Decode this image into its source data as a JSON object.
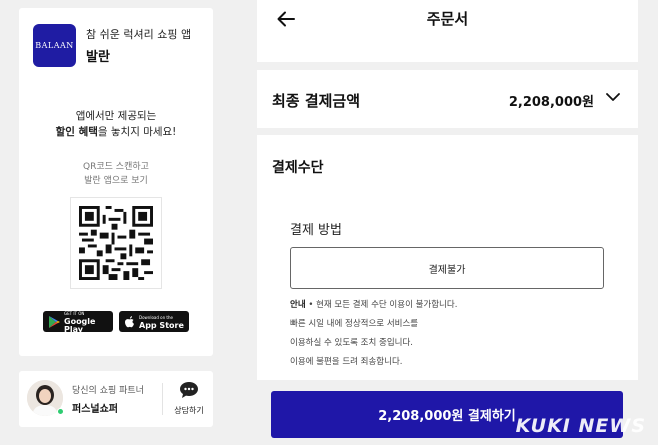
{
  "sidebar": {
    "logo_text": "BALAAN",
    "tagline": "참 쉬운 럭셔리 쇼핑 앱",
    "app_name": "발란",
    "promo_line1": "앱에서만 제공되는",
    "promo_bold": "할인 혜택",
    "promo_line2_rest": "을 놓치지 마세요!",
    "qr_caption_line1": "QR코드 스캔하고",
    "qr_caption_line2": "발란 앱으로 보기",
    "google_play_small": "GET IT ON",
    "google_play_big": "Google Play",
    "app_store_small": "Download on the",
    "app_store_big": "App Store"
  },
  "partner": {
    "subtitle": "당신의 쇼핑 파트너",
    "name": "퍼스널쇼퍼",
    "consult_label": "상담하기"
  },
  "header": {
    "title": "주문서"
  },
  "total": {
    "label": "최종 결제금액",
    "value": "2,208,000원"
  },
  "payment": {
    "section_title": "결제수단",
    "method_label": "결제 방법",
    "method_value": "결제불가",
    "notice_prefix": "안내",
    "notice_line1": " • 현재 모든 결제 수단 이용이 불가합니다.",
    "notice_line2": "빠른 시일 내에 정상적으로 서비스를",
    "notice_line3": "이용하실 수 있도록 조치 중입니다.",
    "notice_line4": "이용에 불편을 드려 죄송합니다."
  },
  "pay_button": {
    "label": "2,208,000원 결제하기"
  },
  "watermark": "KUKI NEWS",
  "colors": {
    "brand": "#1f17a8",
    "background": "#f0f0f0"
  }
}
